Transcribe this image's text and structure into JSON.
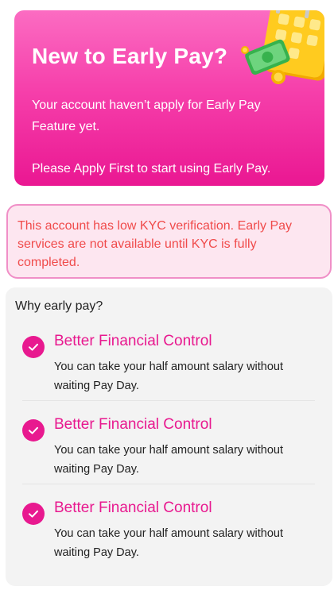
{
  "hero": {
    "title": "New to Early Pay?",
    "description": "Your account haven’t apply for Early Pay Feature yet.",
    "cta_text": "Please Apply First to start using Early Pay.",
    "illustration": "calendar-money-icon"
  },
  "kyc_alert": {
    "message": "This account has low KYC verification. Early Pay services are not available until KYC is fully completed."
  },
  "why": {
    "title": "Why early pay?",
    "items": [
      {
        "title": "Better Financial Control",
        "description": "You can take your half amount salary without waiting Pay Day.",
        "icon": "check-circle-icon"
      },
      {
        "title": "Better Financial Control",
        "description": "You can take your half amount salary without waiting Pay Day.",
        "icon": "check-circle-icon"
      },
      {
        "title": "Better Financial Control",
        "description": "You can take your half amount salary without waiting Pay Day.",
        "icon": "check-circle-icon"
      }
    ]
  },
  "colors": {
    "brand_pink": "#e8198f",
    "hero_gradient_top": "#fb6cc2",
    "alert_text": "#f04b4b",
    "alert_border": "#f08fc7",
    "alert_bg": "#fde6f0"
  }
}
